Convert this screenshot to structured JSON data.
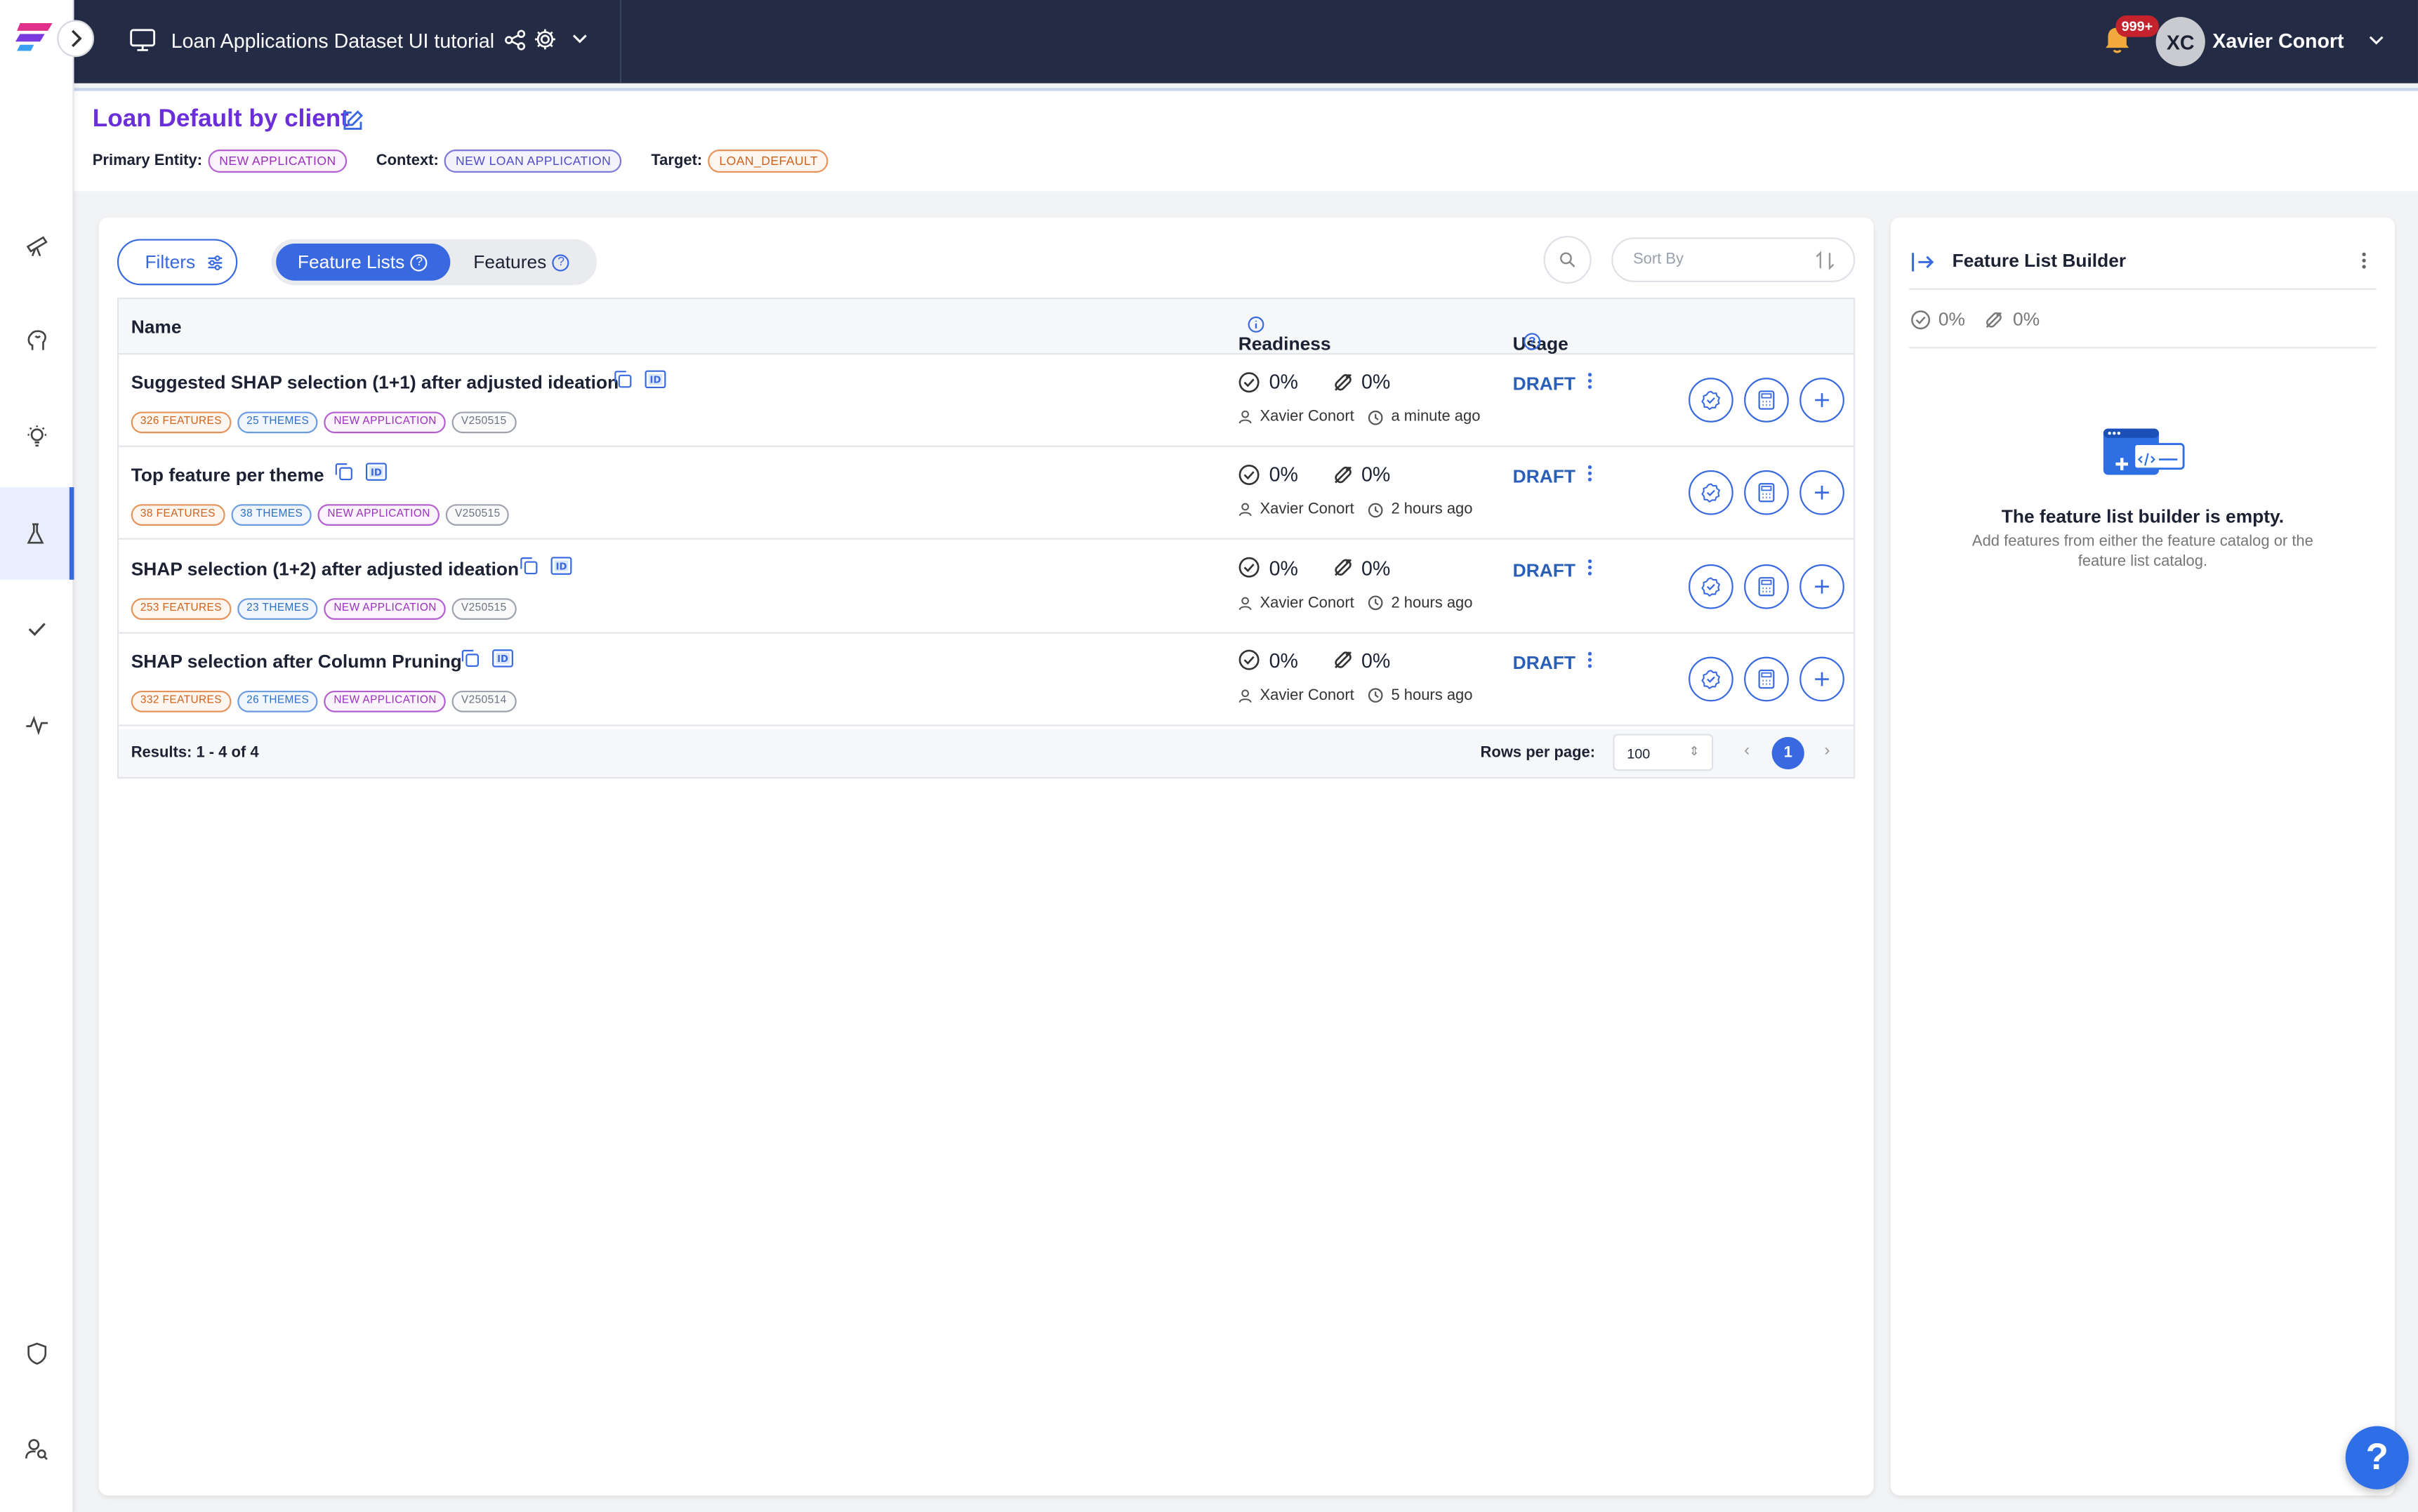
{
  "topbar": {
    "project_title": "Loan Applications Dataset UI tutorial",
    "notification_count": "999+",
    "user_initials": "XC",
    "user_name": "Xavier Conort"
  },
  "header": {
    "title": "Loan Default by client",
    "primary_entity_label": "Primary Entity:",
    "primary_entity_value": "NEW APPLICATION",
    "context_label": "Context:",
    "context_value": "NEW LOAN APPLICATION",
    "target_label": "Target:",
    "target_value": "LOAN_DEFAULT"
  },
  "toolbar": {
    "filters_label": "Filters",
    "tab_feature_lists": "Feature Lists",
    "tab_features": "Features",
    "sort_placeholder": "Sort By"
  },
  "table": {
    "columns": {
      "name": "Name",
      "readiness": "Readiness",
      "usage": "Usage"
    },
    "rows": [
      {
        "name": "Suggested SHAP selection (1+1) after adjusted ideation",
        "features": "326 FEATURES",
        "themes": "25 THEMES",
        "entity": "NEW APPLICATION",
        "version": "V250515",
        "readiness_pct": "0%",
        "online_pct": "0%",
        "owner": "Xavier Conort",
        "time": "a minute ago",
        "status": "DRAFT"
      },
      {
        "name": "Top feature per theme",
        "features": "38 FEATURES",
        "themes": "38 THEMES",
        "entity": "NEW APPLICATION",
        "version": "V250515",
        "readiness_pct": "0%",
        "online_pct": "0%",
        "owner": "Xavier Conort",
        "time": "2 hours ago",
        "status": "DRAFT"
      },
      {
        "name": "SHAP selection (1+2) after adjusted ideation",
        "features": "253 FEATURES",
        "themes": "23 THEMES",
        "entity": "NEW APPLICATION",
        "version": "V250515",
        "readiness_pct": "0%",
        "online_pct": "0%",
        "owner": "Xavier Conort",
        "time": "2 hours ago",
        "status": "DRAFT"
      },
      {
        "name": "SHAP selection after Column Pruning",
        "features": "332 FEATURES",
        "themes": "26 THEMES",
        "entity": "NEW APPLICATION",
        "version": "V250514",
        "readiness_pct": "0%",
        "online_pct": "0%",
        "owner": "Xavier Conort",
        "time": "5 hours ago",
        "status": "DRAFT"
      }
    ],
    "results_text": "Results: 1 - 4 of 4",
    "rows_per_page_label": "Rows per page:",
    "rows_per_page_value": "100",
    "current_page": "1"
  },
  "side_panel": {
    "title": "Feature List Builder",
    "readiness_pct": "0%",
    "online_pct": "0%",
    "empty_title": "The feature list builder is empty.",
    "empty_subtitle": "Add features from either the feature catalog or the feature list catalog."
  },
  "help": {
    "label": "?"
  },
  "colors": {
    "topbar_bg": "#232b45",
    "accent": "#3869e0",
    "title_purple": "#6a2fd8",
    "draft_blue": "#2a5fb8"
  },
  "icons": [
    "logo-icon",
    "chevron-right-icon",
    "telescope-icon",
    "brain-icon",
    "lightbulb-icon",
    "flask-icon",
    "check-icon",
    "pulse-icon",
    "shield-icon",
    "user-search-icon",
    "monitor-icon",
    "share-icon",
    "gear-icon",
    "chevron-down-icon",
    "bell-icon",
    "edit-icon",
    "sliders-icon",
    "help-circle-icon",
    "search-icon",
    "sort-icon",
    "copy-icon",
    "id-icon",
    "check-circle-icon",
    "online-off-icon",
    "user-icon",
    "clock-icon",
    "kebab-icon",
    "approve-icon",
    "calculator-icon",
    "plus-icon",
    "collapse-panel-icon"
  ]
}
